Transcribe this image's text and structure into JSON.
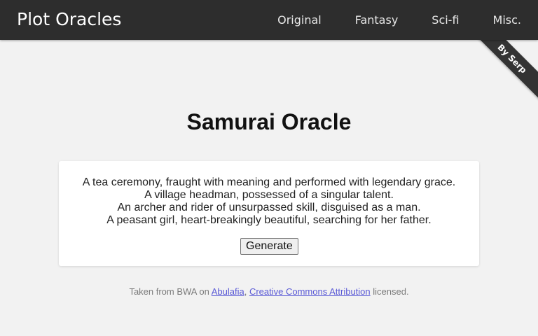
{
  "navbar": {
    "brand": "Plot Oracles",
    "links": [
      "Original",
      "Fantasy",
      "Sci-fi",
      "Misc."
    ]
  },
  "ribbon": {
    "label": "By Serp"
  },
  "main": {
    "title": "Samurai Oracle",
    "lines": [
      "A tea ceremony, fraught with meaning and performed with legendary grace.",
      "A village headman, possessed of a singular talent.",
      "An archer and rider of unsurpassed skill, disguised as a man.",
      "A peasant girl, heart-breakingly beautiful, searching for her father."
    ],
    "generate_label": "Generate"
  },
  "footer": {
    "prefix": "Taken from BWA on ",
    "link1": "Abulafia",
    "separator": ", ",
    "link2": "Creative Commons Attribution",
    "suffix": " licensed."
  },
  "colors": {
    "navbar_bg": "#2d2d2d",
    "page_bg": "#f2f2f2",
    "link": "#5a5ad6"
  }
}
